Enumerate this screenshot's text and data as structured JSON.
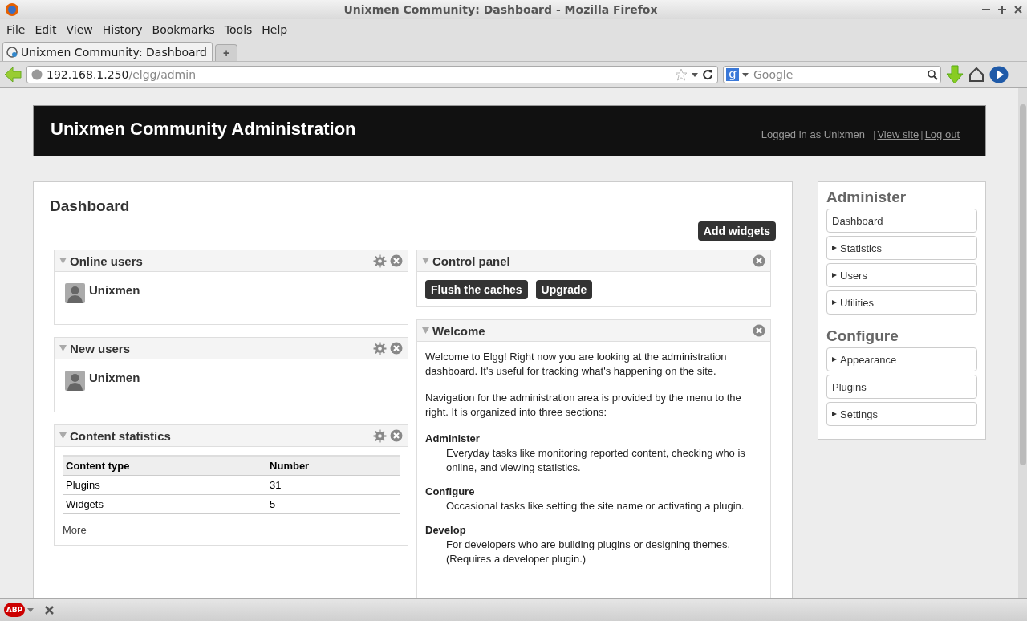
{
  "window": {
    "title": "Unixmen Community: Dashboard - Mozilla Firefox"
  },
  "menu_bar": [
    "File",
    "Edit",
    "View",
    "History",
    "Bookmarks",
    "Tools",
    "Help"
  ],
  "tabs": [
    {
      "label": "Unixmen Community: Dashboard",
      "selected": true
    }
  ],
  "new_tab": "+",
  "address_bar": {
    "host": "192.168.1.250",
    "path": "/elgg/admin"
  },
  "search": {
    "engine_letter": "g",
    "placeholder": "Google"
  },
  "page": {
    "header": {
      "title": "Unixmen Community Administration",
      "logged_in": "Logged in as Unixmen",
      "separator": "|",
      "links": [
        "View site",
        "Log out"
      ]
    },
    "heading": "Dashboard",
    "add_widgets": "Add widgets",
    "left_widgets": [
      {
        "title": "Online users",
        "settings": true,
        "kind": "users",
        "users": [
          "Unixmen"
        ]
      },
      {
        "title": "New users",
        "settings": true,
        "kind": "users",
        "users": [
          "Unixmen"
        ]
      },
      {
        "title": "Content statistics",
        "settings": true,
        "kind": "stats",
        "columns": [
          "Content type",
          "Number"
        ],
        "rows": [
          [
            "Plugins",
            "31"
          ],
          [
            "Widgets",
            "5"
          ]
        ],
        "more": "More"
      }
    ],
    "right_widgets": [
      {
        "title": "Control panel",
        "settings": false,
        "kind": "buttons",
        "buttons": [
          "Flush the caches",
          "Upgrade"
        ]
      },
      {
        "title": "Welcome",
        "settings": false,
        "kind": "text",
        "paragraphs": [
          "Welcome to Elgg! Right now you are looking at the administration dashboard. It's useful for tracking what's happening on the site.",
          "Navigation for the administration area is provided by the menu to the right. It is organized into three sections:"
        ],
        "sections": [
          {
            "term": "Administer",
            "text": "Everyday tasks like monitoring reported content, checking who is online, and viewing statistics."
          },
          {
            "term": "Configure",
            "text": "Occasional tasks like setting the site name or activating a plugin."
          },
          {
            "term": "Develop",
            "text": "For developers who are building plugins or designing themes. (Requires a developer plugin.)"
          }
        ]
      }
    ],
    "sidebar": [
      {
        "heading": "Administer",
        "items": [
          {
            "label": "Dashboard",
            "has_submenu": false
          },
          {
            "label": "Statistics",
            "has_submenu": true
          },
          {
            "label": "Users",
            "has_submenu": true
          },
          {
            "label": "Utilities",
            "has_submenu": true
          }
        ]
      },
      {
        "heading": "Configure",
        "items": [
          {
            "label": "Appearance",
            "has_submenu": true
          },
          {
            "label": "Plugins",
            "has_submenu": false
          },
          {
            "label": "Settings",
            "has_submenu": true
          }
        ]
      }
    ]
  },
  "addon_bar": {
    "abp_label": "ABP"
  }
}
